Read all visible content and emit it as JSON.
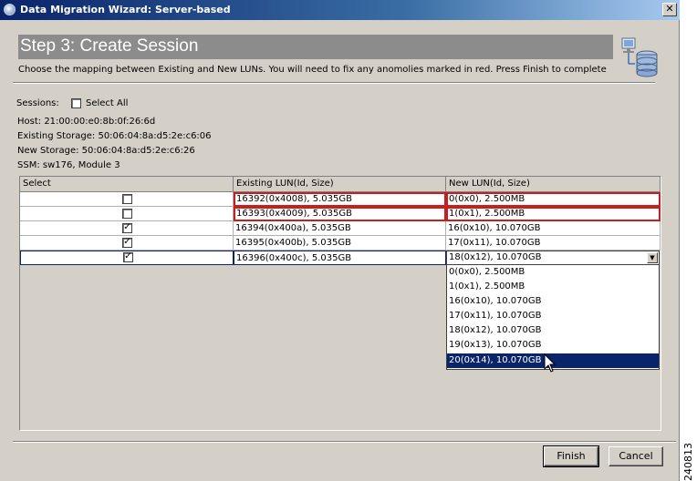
{
  "window": {
    "title": "Data Migration Wizard: Server-based",
    "close_glyph": "✕"
  },
  "header": {
    "step_title": "Step 3: Create Session",
    "instructions": "Choose the mapping between Existing and New LUNs. You will need to fix any anomolies marked in red. Press Finish to complete"
  },
  "sessions": {
    "label": "Sessions:",
    "select_all_label": "Select All",
    "select_all_checked": false
  },
  "info": {
    "host": "Host: 21:00:00:e0:8b:0f:26:6d",
    "existing_storage": "Existing Storage: 50:06:04:8a:d5:2e:c6:06",
    "new_storage": "New Storage: 50:06:04:8a:d5:2e:c6:26",
    "ssm": "SSM: sw176, Module 3"
  },
  "table": {
    "columns": [
      "Select",
      "Existing LUN(Id, Size)",
      "New LUN(Id, Size)"
    ],
    "rows": [
      {
        "checked": false,
        "existing": "16392(0x4008), 5.035GB",
        "new": "0(0x0), 2.500MB",
        "anomaly": true
      },
      {
        "checked": false,
        "existing": "16393(0x4009), 5.035GB",
        "new": "1(0x1), 2.500MB",
        "anomaly": true
      },
      {
        "checked": true,
        "existing": "16394(0x400a), 5.035GB",
        "new": "16(0x10), 10.070GB",
        "anomaly": false
      },
      {
        "checked": true,
        "existing": "16395(0x400b), 5.035GB",
        "new": "17(0x11), 10.070GB",
        "anomaly": false
      },
      {
        "checked": true,
        "existing": "16396(0x400c), 5.035GB",
        "new": "18(0x12), 10.070GB",
        "anomaly": false
      }
    ],
    "check_glyph": "✓"
  },
  "dropdown": {
    "options": [
      "0(0x0), 2.500MB",
      "1(0x1), 2.500MB",
      "16(0x10), 10.070GB",
      "17(0x11), 10.070GB",
      "18(0x12), 10.070GB",
      "19(0x13), 10.070GB",
      "20(0x14), 10.070GB"
    ],
    "highlighted": "20(0x14), 10.070GB",
    "arrow_glyph": "▼"
  },
  "buttons": {
    "finish": "Finish",
    "cancel": "Cancel"
  },
  "figure_id": "240813",
  "colors": {
    "anomaly_border": "#c81e1e",
    "selection": "#0a246a",
    "header_band": "#8c8c8c"
  }
}
